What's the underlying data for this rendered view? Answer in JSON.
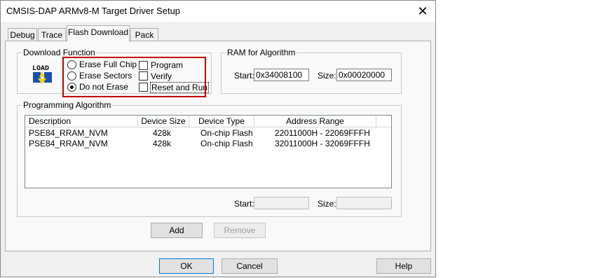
{
  "window": {
    "title": "CMSIS-DAP ARMv8-M Target Driver Setup",
    "close_glyph": "✕"
  },
  "tabs": [
    "Debug",
    "Trace",
    "Flash Download",
    "Pack"
  ],
  "download_function": {
    "group_label": "Download Function",
    "icon": "load-icon",
    "icon_text": "LOAD",
    "radios": [
      {
        "label": "Erase Full Chip",
        "selected": false
      },
      {
        "label": "Erase Sectors",
        "selected": false
      },
      {
        "label": "Do not Erase",
        "selected": true
      }
    ],
    "checks": [
      {
        "label": "Program",
        "checked": false
      },
      {
        "label": "Verify",
        "checked": false
      },
      {
        "label": "Reset and Run",
        "checked": false
      }
    ],
    "highlight_color": "#c00000"
  },
  "ram": {
    "group_label": "RAM for Algorithm",
    "start_label": "Start:",
    "start_value": "0x34008100",
    "size_label": "Size:",
    "size_value": "0x00020000"
  },
  "programming_algorithm": {
    "group_label": "Programming Algorithm",
    "columns": [
      "Description",
      "Device Size",
      "Device Type",
      "Address Range"
    ],
    "rows": [
      [
        "PSE84_RRAM_NVM",
        "428k",
        "On-chip Flash",
        "22011000H - 22069FFFH"
      ],
      [
        "PSE84_RRAM_NVM",
        "428k",
        "On-chip Flash",
        "32011000H - 32069FFFH"
      ]
    ],
    "start_label": "Start:",
    "start_value": "",
    "size_label": "Size:",
    "size_value": ""
  },
  "buttons": {
    "add": "Add",
    "remove": "Remove",
    "ok": "OK",
    "cancel": "Cancel",
    "help": "Help"
  }
}
